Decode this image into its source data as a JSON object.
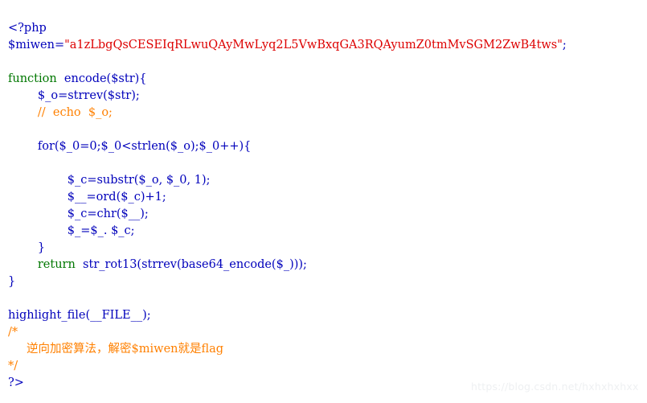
{
  "page": {
    "background_color": "#ffffff",
    "language": "php",
    "renderer": "highlight_file"
  },
  "palette": {
    "default": "#0000BB",
    "keyword": "#007700",
    "string": "#DD0000",
    "comment": "#FF8000",
    "watermark": "#eef0f2"
  },
  "code": {
    "line_01": "<?php",
    "line_02_var": "$miwen=",
    "line_02_string": "\"a1zLbgQsCESEIqRLwuQAyMwLyq2L5VwBxqGA3RQAyumZ0tmMvSGM2ZwB4tws\"",
    "line_02_semi": ";",
    "line_03": "",
    "line_04_kw": "function",
    "line_04_rest": "  encode($str){",
    "line_05": "        $_o=strrev($str);",
    "line_06_comment": "        //  echo  $_o;",
    "line_07": "",
    "line_08": "        for($_0=0;$_0<strlen($_o);$_0++){",
    "line_09": "",
    "line_10": "                $_c=substr($_o, $_0, 1);",
    "line_11": "                $__=ord($_c)+1;",
    "line_12": "                $_c=chr($__);",
    "line_13": "                $_=$_. $_c;",
    "line_14": "        }",
    "line_15_kw": "        return",
    "line_15_rest": "  str_rot13(strrev(base64_encode($_)));",
    "line_16": "}",
    "line_17": "",
    "line_18": "highlight_file(__FILE__);",
    "line_19_comment": "/*",
    "line_20_comment": "     逆向加密算法，解密$miwen就是flag",
    "line_21_comment": "*/",
    "line_22": "?>"
  },
  "watermark": {
    "text": "https://blog.csdn.net/hxhxhxhxx"
  }
}
